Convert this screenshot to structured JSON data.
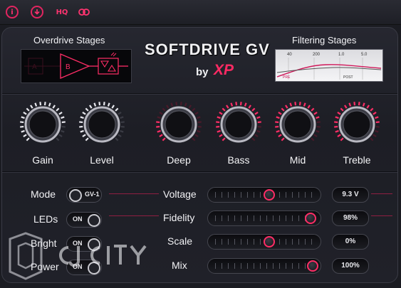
{
  "toolbar": {
    "buttons": [
      {
        "name": "info-icon",
        "glyph": "i"
      },
      {
        "name": "download-icon",
        "glyph": ""
      },
      {
        "name": "hq-button",
        "glyph": "HQ"
      },
      {
        "name": "link-icon",
        "glyph": ""
      }
    ]
  },
  "header": {
    "overdrive_label": "Overdrive Stages",
    "overdrive_stage_a": "A",
    "overdrive_stage_b": "B",
    "filtering_label": "Filtering Stages",
    "filter_ticks": [
      "40",
      "200",
      "1.0",
      "5.0"
    ],
    "filter_pre": "PRE",
    "filter_post": "POST",
    "brand_title": "SOFTDRIVE GV",
    "brand_by": "by",
    "brand_logo": "XP"
  },
  "knobs": [
    {
      "label": "Gain",
      "level": 0.85,
      "style": "white"
    },
    {
      "label": "Level",
      "level": 0.7,
      "style": "white"
    },
    {
      "label": "Deep",
      "level": 0.2,
      "style": "pink"
    },
    {
      "label": "Bass",
      "level": 0.85,
      "style": "pink"
    },
    {
      "label": "Mid",
      "level": 0.8,
      "style": "pink"
    },
    {
      "label": "Treble",
      "level": 0.85,
      "style": "pink"
    }
  ],
  "switches": [
    {
      "label": "Mode",
      "text": "GV-1"
    },
    {
      "label": "LEDs",
      "text": "ON"
    },
    {
      "label": "Bright",
      "text": "ON"
    },
    {
      "label": "Power",
      "text": "ON"
    }
  ],
  "sliders": [
    {
      "label": "Voltage",
      "value": "9.3 V",
      "position": 0.55
    },
    {
      "label": "Fidelity",
      "value": "98%",
      "position": 0.98
    },
    {
      "label": "Scale",
      "value": "0%",
      "position": 0.55
    },
    {
      "label": "Mix",
      "value": "100%",
      "position": 1.0
    }
  ],
  "watermark": {
    "text": "CJ City"
  },
  "colors": {
    "accent": "#ff2d66",
    "panel": "#1d1e25"
  }
}
